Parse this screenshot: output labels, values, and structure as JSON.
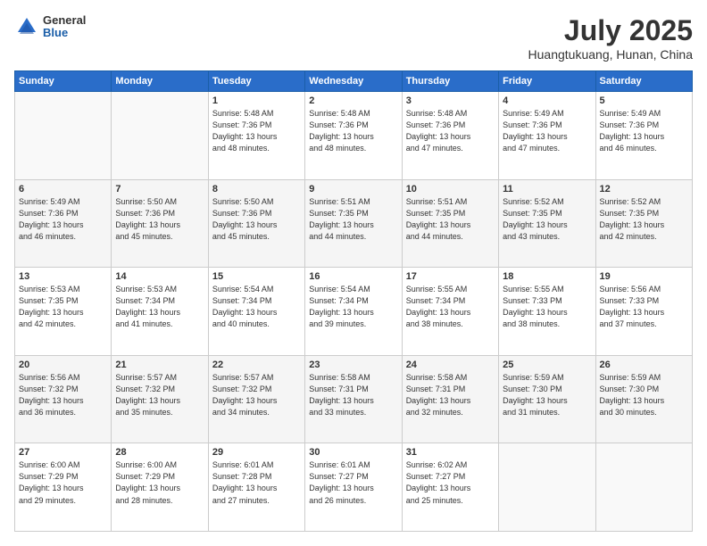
{
  "logo": {
    "general": "General",
    "blue": "Blue"
  },
  "header": {
    "month": "July 2025",
    "location": "Huangtukuang, Hunan, China"
  },
  "weekdays": [
    "Sunday",
    "Monday",
    "Tuesday",
    "Wednesday",
    "Thursday",
    "Friday",
    "Saturday"
  ],
  "weeks": [
    [
      {
        "day": "",
        "info": ""
      },
      {
        "day": "",
        "info": ""
      },
      {
        "day": "1",
        "info": "Sunrise: 5:48 AM\nSunset: 7:36 PM\nDaylight: 13 hours\nand 48 minutes."
      },
      {
        "day": "2",
        "info": "Sunrise: 5:48 AM\nSunset: 7:36 PM\nDaylight: 13 hours\nand 48 minutes."
      },
      {
        "day": "3",
        "info": "Sunrise: 5:48 AM\nSunset: 7:36 PM\nDaylight: 13 hours\nand 47 minutes."
      },
      {
        "day": "4",
        "info": "Sunrise: 5:49 AM\nSunset: 7:36 PM\nDaylight: 13 hours\nand 47 minutes."
      },
      {
        "day": "5",
        "info": "Sunrise: 5:49 AM\nSunset: 7:36 PM\nDaylight: 13 hours\nand 46 minutes."
      }
    ],
    [
      {
        "day": "6",
        "info": "Sunrise: 5:49 AM\nSunset: 7:36 PM\nDaylight: 13 hours\nand 46 minutes."
      },
      {
        "day": "7",
        "info": "Sunrise: 5:50 AM\nSunset: 7:36 PM\nDaylight: 13 hours\nand 45 minutes."
      },
      {
        "day": "8",
        "info": "Sunrise: 5:50 AM\nSunset: 7:36 PM\nDaylight: 13 hours\nand 45 minutes."
      },
      {
        "day": "9",
        "info": "Sunrise: 5:51 AM\nSunset: 7:35 PM\nDaylight: 13 hours\nand 44 minutes."
      },
      {
        "day": "10",
        "info": "Sunrise: 5:51 AM\nSunset: 7:35 PM\nDaylight: 13 hours\nand 44 minutes."
      },
      {
        "day": "11",
        "info": "Sunrise: 5:52 AM\nSunset: 7:35 PM\nDaylight: 13 hours\nand 43 minutes."
      },
      {
        "day": "12",
        "info": "Sunrise: 5:52 AM\nSunset: 7:35 PM\nDaylight: 13 hours\nand 42 minutes."
      }
    ],
    [
      {
        "day": "13",
        "info": "Sunrise: 5:53 AM\nSunset: 7:35 PM\nDaylight: 13 hours\nand 42 minutes."
      },
      {
        "day": "14",
        "info": "Sunrise: 5:53 AM\nSunset: 7:34 PM\nDaylight: 13 hours\nand 41 minutes."
      },
      {
        "day": "15",
        "info": "Sunrise: 5:54 AM\nSunset: 7:34 PM\nDaylight: 13 hours\nand 40 minutes."
      },
      {
        "day": "16",
        "info": "Sunrise: 5:54 AM\nSunset: 7:34 PM\nDaylight: 13 hours\nand 39 minutes."
      },
      {
        "day": "17",
        "info": "Sunrise: 5:55 AM\nSunset: 7:34 PM\nDaylight: 13 hours\nand 38 minutes."
      },
      {
        "day": "18",
        "info": "Sunrise: 5:55 AM\nSunset: 7:33 PM\nDaylight: 13 hours\nand 38 minutes."
      },
      {
        "day": "19",
        "info": "Sunrise: 5:56 AM\nSunset: 7:33 PM\nDaylight: 13 hours\nand 37 minutes."
      }
    ],
    [
      {
        "day": "20",
        "info": "Sunrise: 5:56 AM\nSunset: 7:32 PM\nDaylight: 13 hours\nand 36 minutes."
      },
      {
        "day": "21",
        "info": "Sunrise: 5:57 AM\nSunset: 7:32 PM\nDaylight: 13 hours\nand 35 minutes."
      },
      {
        "day": "22",
        "info": "Sunrise: 5:57 AM\nSunset: 7:32 PM\nDaylight: 13 hours\nand 34 minutes."
      },
      {
        "day": "23",
        "info": "Sunrise: 5:58 AM\nSunset: 7:31 PM\nDaylight: 13 hours\nand 33 minutes."
      },
      {
        "day": "24",
        "info": "Sunrise: 5:58 AM\nSunset: 7:31 PM\nDaylight: 13 hours\nand 32 minutes."
      },
      {
        "day": "25",
        "info": "Sunrise: 5:59 AM\nSunset: 7:30 PM\nDaylight: 13 hours\nand 31 minutes."
      },
      {
        "day": "26",
        "info": "Sunrise: 5:59 AM\nSunset: 7:30 PM\nDaylight: 13 hours\nand 30 minutes."
      }
    ],
    [
      {
        "day": "27",
        "info": "Sunrise: 6:00 AM\nSunset: 7:29 PM\nDaylight: 13 hours\nand 29 minutes."
      },
      {
        "day": "28",
        "info": "Sunrise: 6:00 AM\nSunset: 7:29 PM\nDaylight: 13 hours\nand 28 minutes."
      },
      {
        "day": "29",
        "info": "Sunrise: 6:01 AM\nSunset: 7:28 PM\nDaylight: 13 hours\nand 27 minutes."
      },
      {
        "day": "30",
        "info": "Sunrise: 6:01 AM\nSunset: 7:27 PM\nDaylight: 13 hours\nand 26 minutes."
      },
      {
        "day": "31",
        "info": "Sunrise: 6:02 AM\nSunset: 7:27 PM\nDaylight: 13 hours\nand 25 minutes."
      },
      {
        "day": "",
        "info": ""
      },
      {
        "day": "",
        "info": ""
      }
    ]
  ]
}
